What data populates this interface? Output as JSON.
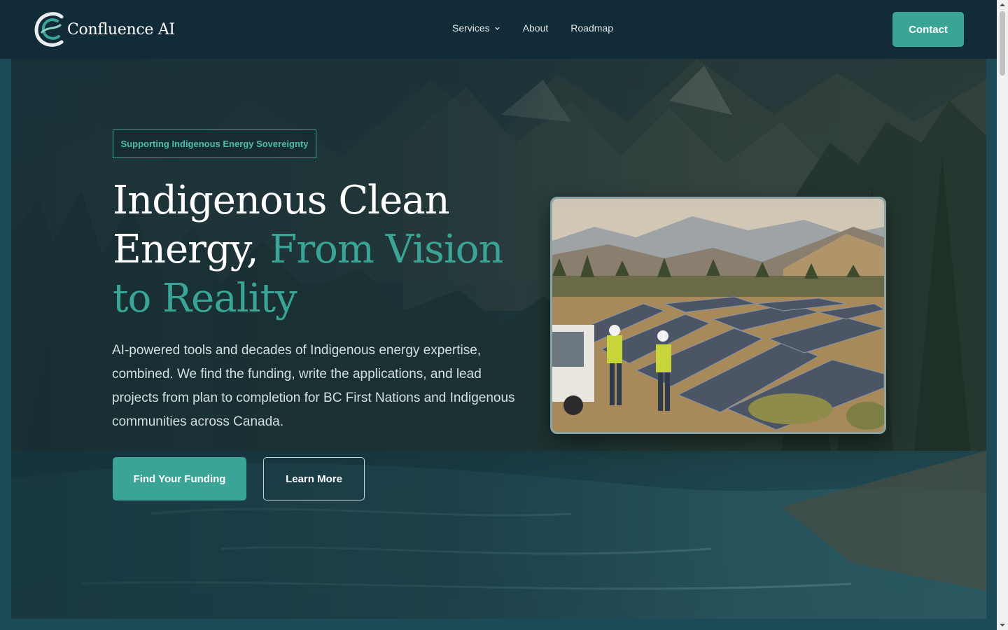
{
  "brand": {
    "name": "Confluence AI",
    "logo_icon": "confluence-logo-icon"
  },
  "nav": {
    "links": [
      {
        "label": "Services",
        "has_dropdown": true,
        "icon": "chevron-down-icon"
      },
      {
        "label": "About"
      },
      {
        "label": "Roadmap"
      }
    ],
    "contact_label": "Contact"
  },
  "hero": {
    "badge": "Supporting Indigenous Energy Sovereignty",
    "headline_line1": "Indigenous Clean",
    "headline_line2_white": "Energy,",
    "headline_line2_accent": "From Vision",
    "headline_line3_accent": "to Reality",
    "description": "AI-powered tools and decades of Indigenous energy expertise, combined. We find the funding, write the applications, and lead projects from plan to completion for BC First Nations and Indigenous communities across Canada.",
    "primary_cta": "Find Your Funding",
    "secondary_cta": "Learn More",
    "photo_subject": "solar-farm-workers-photo"
  },
  "colors": {
    "accent": "#3aa597",
    "nav_bg": "#122b38",
    "text_light": "#d4dfe0"
  }
}
